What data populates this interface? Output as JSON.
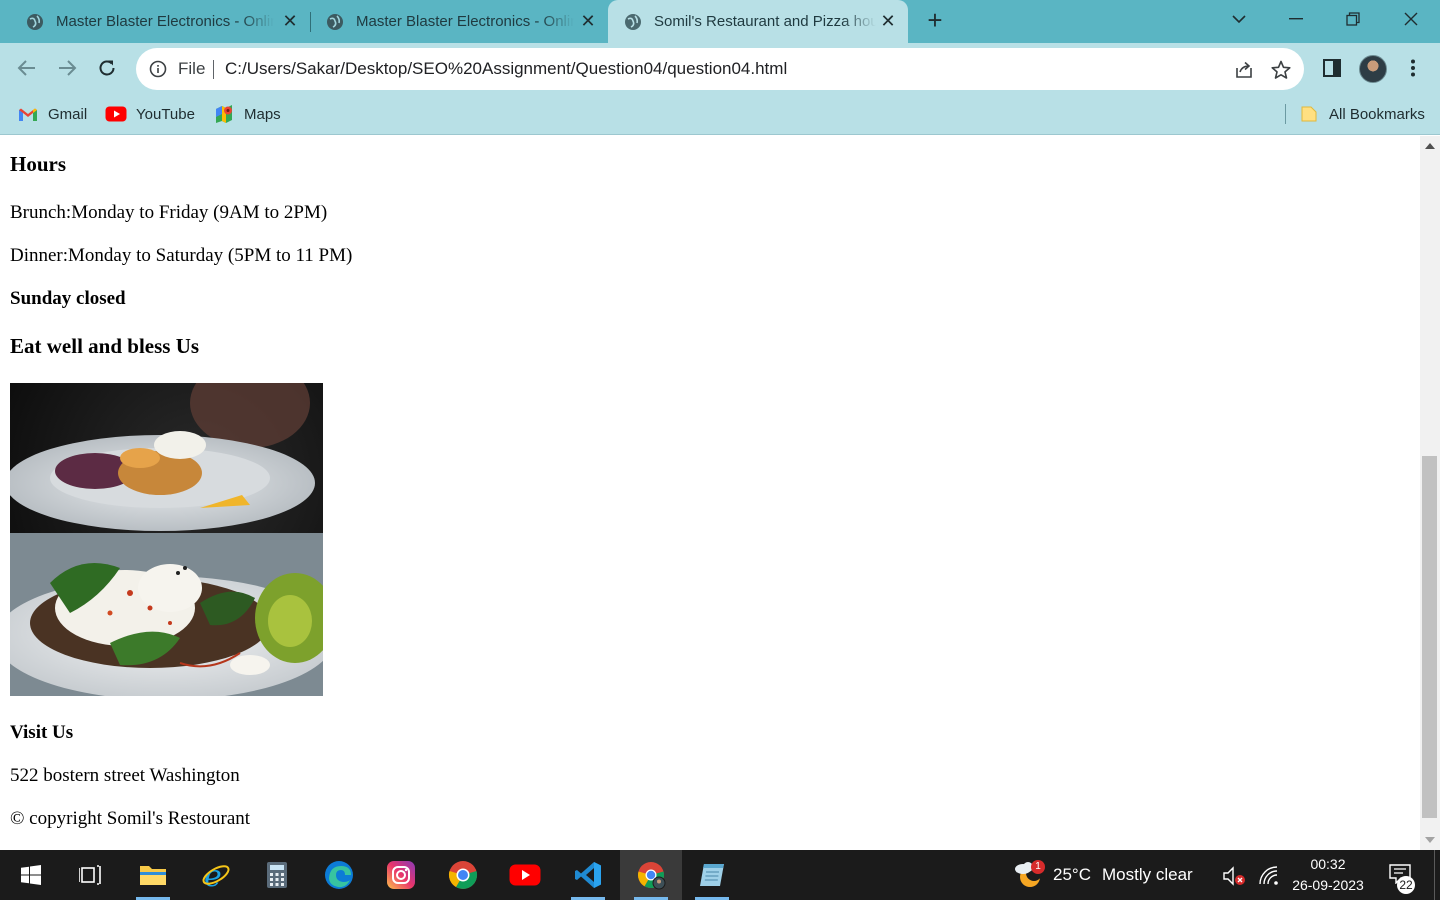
{
  "browser": {
    "tabs": [
      {
        "title": "Master Blaster Electronics - Online Store",
        "active": false
      },
      {
        "title": "Master Blaster Electronics - Online Store",
        "active": false
      },
      {
        "title": "Somil's Restaurant and Pizza house",
        "active": true
      }
    ],
    "address_bar": {
      "scheme_label": "File",
      "url": "C:/Users/Sakar/Desktop/SEO%20Assignment/Question04/question04.html"
    },
    "bookmarks": [
      {
        "label": "Gmail",
        "icon": "gmail-icon"
      },
      {
        "label": "YouTube",
        "icon": "youtube-icon"
      },
      {
        "label": "Maps",
        "icon": "maps-icon"
      }
    ],
    "all_bookmarks_label": "All Bookmarks",
    "colors": {
      "frame": "#5ab5c3",
      "toolbar": "#b8e0e6"
    }
  },
  "page": {
    "hours_heading": "Hours",
    "brunch": "Brunch:Monday to Friday (9AM to 2PM)",
    "dinner": "Dinner:Monday to Saturday (5PM to 11 PM)",
    "closed": "Sunday closed",
    "tagline": "Eat well and bless Us",
    "image_alt": "Plate of poached eggs on toast with herbs and avocado",
    "visit_heading": "Visit Us",
    "address": "522 bostern street Washington",
    "copyright": "© copyright Somil's Restourant"
  },
  "taskbar": {
    "apps": [
      "start-icon",
      "task-view-icon",
      "file-explorer-icon",
      "internet-explorer-icon",
      "edge-icon",
      "calculator-icon",
      "instagram-icon",
      "chrome-icon",
      "youtube-app-icon",
      "vscode-icon",
      "chrome-profile-icon",
      "notepad-icon"
    ],
    "weather": {
      "temp": "25°C",
      "condition": "Mostly clear",
      "badge": "1"
    },
    "time": "00:32",
    "date": "26-09-2023",
    "notifications": "22"
  }
}
